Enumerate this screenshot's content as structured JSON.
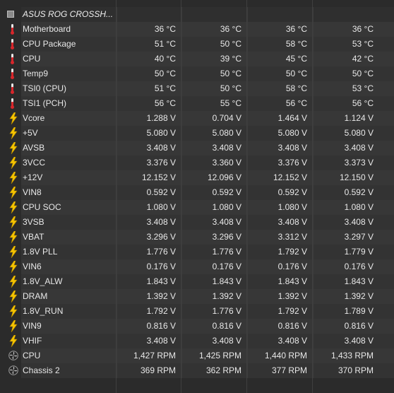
{
  "group": {
    "title": "ASUS ROG CROSSH..."
  },
  "sensors": [
    {
      "icon": "thermometer-icon",
      "name": "Motherboard",
      "values": [
        "36 °C",
        "36 °C",
        "36 °C",
        "36 °C"
      ]
    },
    {
      "icon": "thermometer-icon",
      "name": "CPU Package",
      "values": [
        "51 °C",
        "50 °C",
        "58 °C",
        "53 °C"
      ]
    },
    {
      "icon": "thermometer-icon",
      "name": "CPU",
      "values": [
        "40 °C",
        "39 °C",
        "45 °C",
        "42 °C"
      ]
    },
    {
      "icon": "thermometer-icon",
      "name": "Temp9",
      "values": [
        "50 °C",
        "50 °C",
        "50 °C",
        "50 °C"
      ]
    },
    {
      "icon": "thermometer-icon",
      "name": "TSI0 (CPU)",
      "values": [
        "51 °C",
        "50 °C",
        "58 °C",
        "53 °C"
      ]
    },
    {
      "icon": "thermometer-icon",
      "name": "TSI1 (PCH)",
      "values": [
        "56 °C",
        "55 °C",
        "56 °C",
        "56 °C"
      ]
    },
    {
      "icon": "lightning-bolt-icon",
      "name": "Vcore",
      "values": [
        "1.288 V",
        "0.704 V",
        "1.464 V",
        "1.124 V"
      ]
    },
    {
      "icon": "lightning-bolt-icon",
      "name": "+5V",
      "values": [
        "5.080 V",
        "5.080 V",
        "5.080 V",
        "5.080 V"
      ]
    },
    {
      "icon": "lightning-bolt-icon",
      "name": "AVSB",
      "values": [
        "3.408 V",
        "3.408 V",
        "3.408 V",
        "3.408 V"
      ]
    },
    {
      "icon": "lightning-bolt-icon",
      "name": "3VCC",
      "values": [
        "3.376 V",
        "3.360 V",
        "3.376 V",
        "3.373 V"
      ]
    },
    {
      "icon": "lightning-bolt-icon",
      "name": "+12V",
      "values": [
        "12.152 V",
        "12.096 V",
        "12.152 V",
        "12.150 V"
      ]
    },
    {
      "icon": "lightning-bolt-icon",
      "name": "VIN8",
      "values": [
        "0.592 V",
        "0.592 V",
        "0.592 V",
        "0.592 V"
      ]
    },
    {
      "icon": "lightning-bolt-icon",
      "name": "CPU SOC",
      "values": [
        "1.080 V",
        "1.080 V",
        "1.080 V",
        "1.080 V"
      ]
    },
    {
      "icon": "lightning-bolt-icon",
      "name": "3VSB",
      "values": [
        "3.408 V",
        "3.408 V",
        "3.408 V",
        "3.408 V"
      ]
    },
    {
      "icon": "lightning-bolt-icon",
      "name": "VBAT",
      "values": [
        "3.296 V",
        "3.296 V",
        "3.312 V",
        "3.297 V"
      ]
    },
    {
      "icon": "lightning-bolt-icon",
      "name": "1.8V PLL",
      "values": [
        "1.776 V",
        "1.776 V",
        "1.792 V",
        "1.779 V"
      ]
    },
    {
      "icon": "lightning-bolt-icon",
      "name": "VIN6",
      "values": [
        "0.176 V",
        "0.176 V",
        "0.176 V",
        "0.176 V"
      ]
    },
    {
      "icon": "lightning-bolt-icon",
      "name": "1.8V_ALW",
      "values": [
        "1.843 V",
        "1.843 V",
        "1.843 V",
        "1.843 V"
      ]
    },
    {
      "icon": "lightning-bolt-icon",
      "name": "DRAM",
      "values": [
        "1.392 V",
        "1.392 V",
        "1.392 V",
        "1.392 V"
      ]
    },
    {
      "icon": "lightning-bolt-icon",
      "name": "1.8V_RUN",
      "values": [
        "1.792 V",
        "1.776 V",
        "1.792 V",
        "1.789 V"
      ]
    },
    {
      "icon": "lightning-bolt-icon",
      "name": "VIN9",
      "values": [
        "0.816 V",
        "0.816 V",
        "0.816 V",
        "0.816 V"
      ]
    },
    {
      "icon": "lightning-bolt-icon",
      "name": "VHIF",
      "values": [
        "3.408 V",
        "3.408 V",
        "3.408 V",
        "3.408 V"
      ]
    },
    {
      "icon": "fan-icon",
      "name": "CPU",
      "values": [
        "1,427 RPM",
        "1,425 RPM",
        "1,440 RPM",
        "1,433 RPM"
      ]
    },
    {
      "icon": "fan-icon",
      "name": "Chassis 2",
      "values": [
        "369 RPM",
        "362 RPM",
        "377 RPM",
        "370 RPM"
      ]
    }
  ],
  "colors": {
    "background": "#2b2b2b",
    "row": "#373737",
    "text": "#e8e8e8",
    "thermometer_red": "#d8262b",
    "bolt_yellow": "#f5c400"
  }
}
